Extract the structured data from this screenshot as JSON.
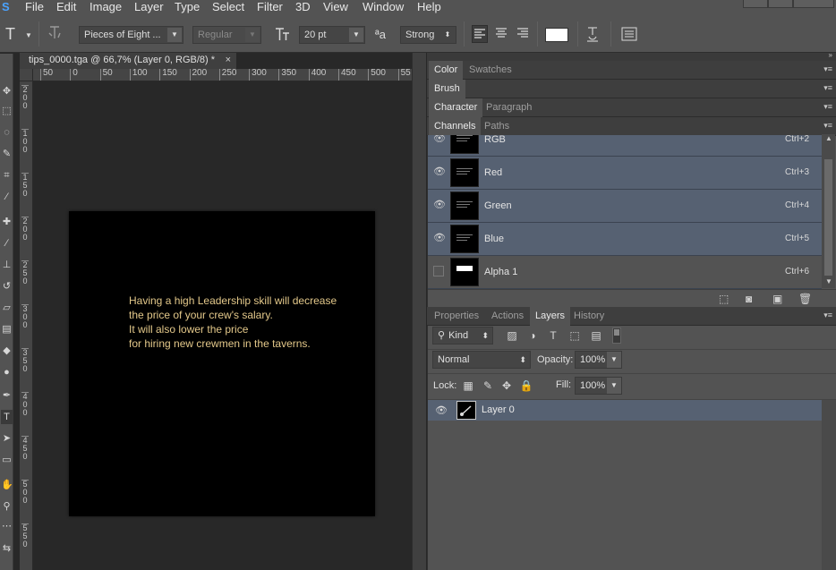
{
  "menubar": {
    "app_logo": "S",
    "items": [
      "File",
      "Edit",
      "Image",
      "Layer",
      "Type",
      "Select",
      "Filter",
      "3D",
      "View",
      "Window",
      "Help"
    ]
  },
  "options": {
    "tool_icon": "T",
    "font_family": "Pieces of Eight ...",
    "font_style": "Regular",
    "font_size": "20 pt",
    "aa_label": "ªa",
    "anti_alias": "Strong"
  },
  "document": {
    "tab_title": "tips_0000.tga @ 66,7% (Layer 0, RGB/8) *",
    "ruler_h": [
      "50",
      "0",
      "50",
      "100",
      "150",
      "200",
      "250",
      "300",
      "350",
      "400",
      "450",
      "500",
      "55"
    ],
    "ruler_v": [
      "200",
      "100",
      "150",
      "200",
      "250",
      "300",
      "350",
      "400",
      "450",
      "500",
      "550"
    ],
    "canvas_text": [
      "Having a high Leadership skill will decrease",
      "the price of your crew's salary.",
      "It will also lower the price",
      "for hiring new crewmen in the taverns."
    ],
    "text_color": "#e3c88a"
  },
  "panels": {
    "color_tabs": [
      "Color",
      "Swatches"
    ],
    "brush_tabs": [
      "Brush"
    ],
    "character_tabs": [
      "Character",
      "Paragraph"
    ],
    "channels_tabs": [
      "Channels",
      "Paths"
    ],
    "channels": [
      {
        "name": "RGB",
        "shortcut": "Ctrl+2"
      },
      {
        "name": "Red",
        "shortcut": "Ctrl+3"
      },
      {
        "name": "Green",
        "shortcut": "Ctrl+4"
      },
      {
        "name": "Blue",
        "shortcut": "Ctrl+5"
      },
      {
        "name": "Alpha 1",
        "shortcut": "Ctrl+6"
      }
    ],
    "layers_tabs": [
      "Properties",
      "Actions",
      "Layers",
      "History"
    ],
    "layers": {
      "filter_kind": "Kind",
      "blend_mode": "Normal",
      "opacity_label": "Opacity:",
      "opacity": "100%",
      "lock_label": "Lock:",
      "fill_label": "Fill:",
      "fill": "100%",
      "items": [
        {
          "name": "Layer 0"
        }
      ]
    }
  },
  "colors": {
    "selection": "#566172",
    "panel": "#535353"
  }
}
